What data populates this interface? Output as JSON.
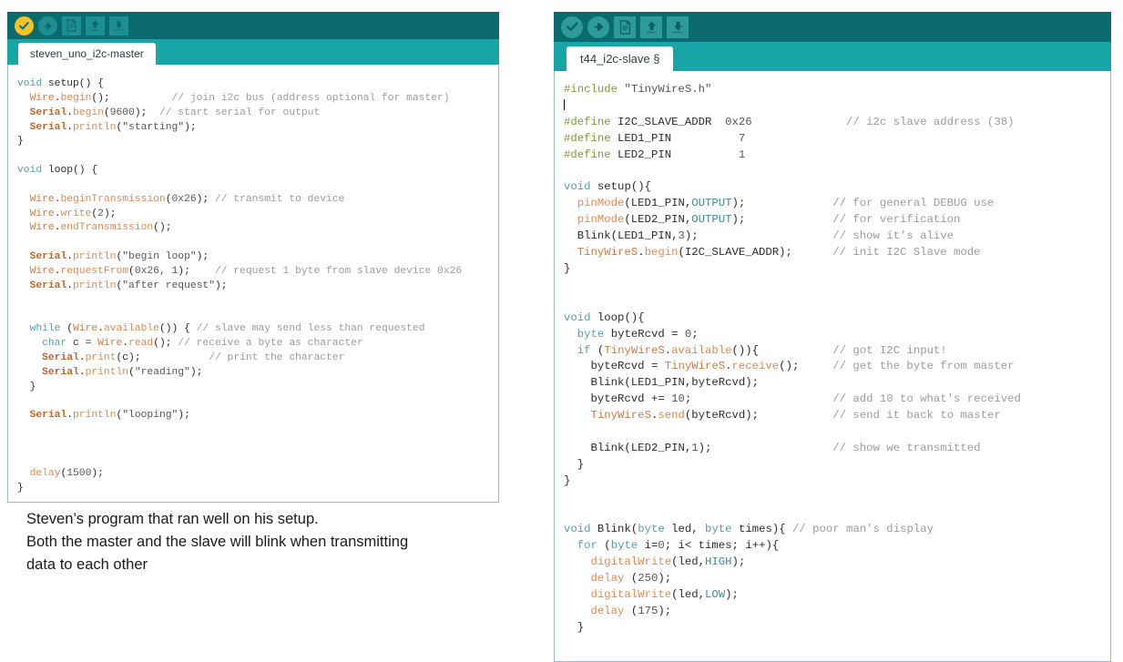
{
  "left_editor": {
    "tab_label": "steven_uno_i2c-master",
    "toolbar": {
      "buttons": [
        {
          "name": "verify-button",
          "icon": "check-icon",
          "label": "Verify",
          "bg": "#f4c325",
          "fg": "#0a6a6e",
          "shape": "round"
        },
        {
          "name": "upload-button",
          "icon": "arrow-right-icon",
          "label": "Upload",
          "bg": "#1d8e92",
          "fg": "#0a6a6e",
          "shape": "round"
        },
        {
          "name": "new-button",
          "icon": "new-file-icon",
          "label": "New",
          "bg": "#1d8e92",
          "fg": "#0a6a6e",
          "shape": "square"
        },
        {
          "name": "open-button",
          "icon": "arrow-up-icon",
          "label": "Open",
          "bg": "#1d8e92",
          "fg": "#0a6a6e",
          "shape": "square"
        },
        {
          "name": "save-button",
          "icon": "arrow-down-icon",
          "label": "Save",
          "bg": "#1d8e92",
          "fg": "#0a6a6e",
          "shape": "square"
        }
      ]
    }
  },
  "right_editor": {
    "tab_label": "t44_i2c-slave §",
    "toolbar": {
      "buttons": [
        {
          "name": "verify-button",
          "icon": "check-icon",
          "label": "Verify",
          "bg": "#2d9a9c",
          "fg": "#0a6a6e",
          "shape": "round"
        },
        {
          "name": "upload-button",
          "icon": "arrow-right-icon",
          "label": "Upload",
          "bg": "#2d9a9c",
          "fg": "#0a6a6e",
          "shape": "round"
        },
        {
          "name": "new-button",
          "icon": "new-file-icon",
          "label": "New",
          "bg": "#2d9a9c",
          "fg": "#0a6a6e",
          "shape": "square"
        },
        {
          "name": "open-button",
          "icon": "arrow-up-icon",
          "label": "Open",
          "bg": "#2d9a9c",
          "fg": "#0a6a6e",
          "shape": "square"
        },
        {
          "name": "save-button",
          "icon": "arrow-down-icon",
          "label": "Save",
          "bg": "#2d9a9c",
          "fg": "#0a6a6e",
          "shape": "square"
        }
      ]
    }
  },
  "caption": {
    "line1": "Steven’s program that ran well on his setup.",
    "line2": "Both the master and the slave will blink when transmitting",
    "line3": "data to each other"
  },
  "colors": {
    "toolbar_bg": "#0a6a6e",
    "tabbar_bg": "#17a5a5",
    "tab_bg": "#ffffff",
    "editor_bg": "#ffffff",
    "editor_border": "#9fb6cc",
    "verify_active": "#f4c325",
    "keyword": "#5a9ea8",
    "library": "#d07a46",
    "function": "#e08a54",
    "comment": "#9b9b9b",
    "preprocessor": "#7d9b3a"
  },
  "left_code_plain": "void setup() {\n  Wire.begin();          // join i2c bus (address optional for master)\n  Serial.begin(9600);  // start serial for output\n  Serial.println(\"starting\");\n}\n\nvoid loop() {\n\n  Wire.beginTransmission(0x26); // transmit to device\n  Wire.write(2);\n  Wire.endTransmission();\n\n  Serial.println(\"begin loop\");\n  Wire.requestFrom(0x26, 1);    // request 1 byte from slave device 0x26\n  Serial.println(\"after request\");\n\n\n  while (Wire.available()) { // slave may send less than requested\n    char c = Wire.read(); // receive a byte as character\n    Serial.print(c);           // print the character\n    Serial.println(\"reading\");\n  }\n\n  Serial.println(\"looping\");\n\n\n\n  delay(1500);\n}",
  "right_code_plain": "#include \"TinyWireS.h\"\n\n#define I2C_SLAVE_ADDR  0x26              // i2c slave address (38)\n#define LED1_PIN          7\n#define LED2_PIN          1\n\nvoid setup(){\n  pinMode(LED1_PIN,OUTPUT);             // for general DEBUG use\n  pinMode(LED2_PIN,OUTPUT);             // for verification\n  Blink(LED1_PIN,3);                    // show it's alive\n  TinyWireS.begin(I2C_SLAVE_ADDR);      // init I2C Slave mode\n}\n\n\nvoid loop(){\n  byte byteRcvd = 0;\n  if (TinyWireS.available()){           // got I2C input!\n    byteRcvd = TinyWireS.receive();     // get the byte from master\n    Blink(LED1_PIN,byteRcvd);\n    byteRcvd += 10;                     // add 10 to what's received\n    TinyWireS.send(byteRcvd);           // send it back to master\n\n    Blink(LED2_PIN,1);                  // show we transmitted\n  }\n}\n\n\nvoid Blink(byte led, byte times){ // poor man's display\n  for (byte i=0; i< times; i++){\n    digitalWrite(led,HIGH);\n    delay (250);\n    digitalWrite(led,LOW);\n    delay (175);\n  }"
}
